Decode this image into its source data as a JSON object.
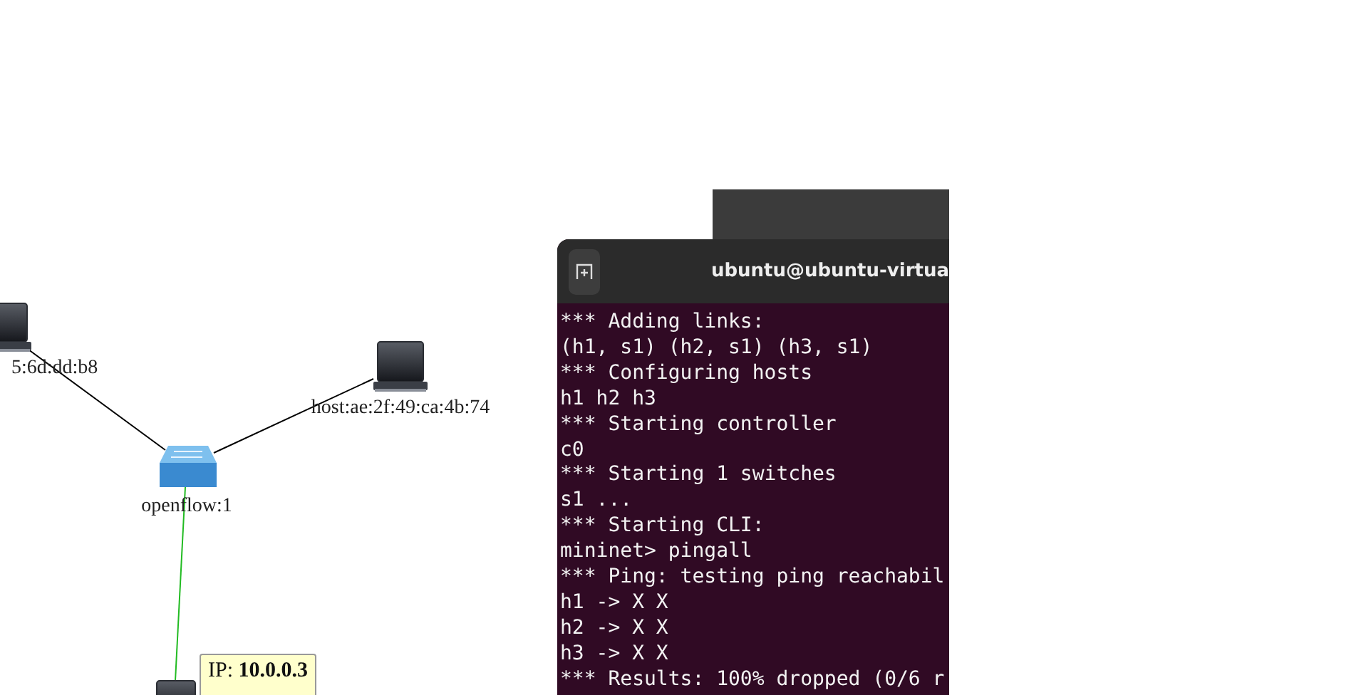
{
  "topology": {
    "nodes": [
      {
        "kind": "host",
        "label": "5:6d:dd:b8"
      },
      {
        "kind": "host",
        "label": "host:ae:2f:49:ca:4b:74"
      },
      {
        "kind": "switch",
        "label": "openflow:1"
      },
      {
        "kind": "host"
      }
    ],
    "links": [
      {
        "color": "#000000"
      },
      {
        "color": "#000000"
      },
      {
        "color": "#22bb22"
      }
    ],
    "tooltip": {
      "text": "IP: **10.0.0.3**"
    }
  },
  "terminal": {
    "title": "ubuntu@ubuntu-virtua",
    "lines": [
      "*** Adding links:",
      "(h1, s1) (h2, s1) (h3, s1)",
      "*** Configuring hosts",
      "h1 h2 h3",
      "*** Starting controller",
      "c0",
      "*** Starting 1 switches",
      "s1 ...",
      "*** Starting CLI:",
      "mininet> pingall",
      "*** Ping: testing ping reachabil",
      "h1 -> X X",
      "h2 -> X X",
      "h3 -> X X",
      "*** Results: 100% dropped (0/6 r"
    ]
  }
}
